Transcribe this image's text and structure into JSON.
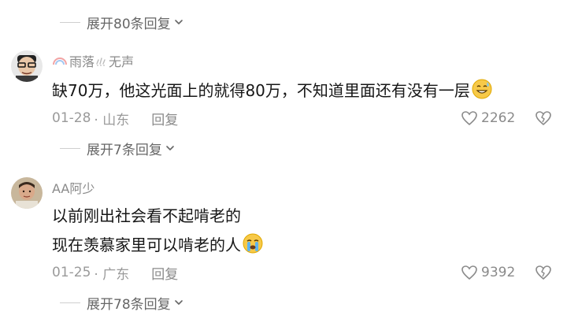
{
  "top_thread": {
    "expand_label": "展开80条回复"
  },
  "comments": [
    {
      "username": "雨落",
      "username_suffix": "无声",
      "lines": [
        "缺70万，他这光面上的就得80万，不知道里面还有没有一层"
      ],
      "emoji": "grin-sweat-emoji",
      "date": "01-28",
      "location": "· 山东",
      "reply_label": "回复",
      "likes": "2262",
      "expand_label": "展开7条回复"
    },
    {
      "username": "AA阿少",
      "lines": [
        "以前刚出社会看不起啃老的",
        "现在羡慕家里可以啃老的人"
      ],
      "emoji": "crying-emoji",
      "date": "01-25",
      "location": "· 广东",
      "reply_label": "回复",
      "likes": "9392",
      "expand_label": "展开78条回复"
    }
  ],
  "colors": {
    "text": "#161616",
    "muted": "#9a9a9a",
    "username": "#8a8a8a"
  }
}
